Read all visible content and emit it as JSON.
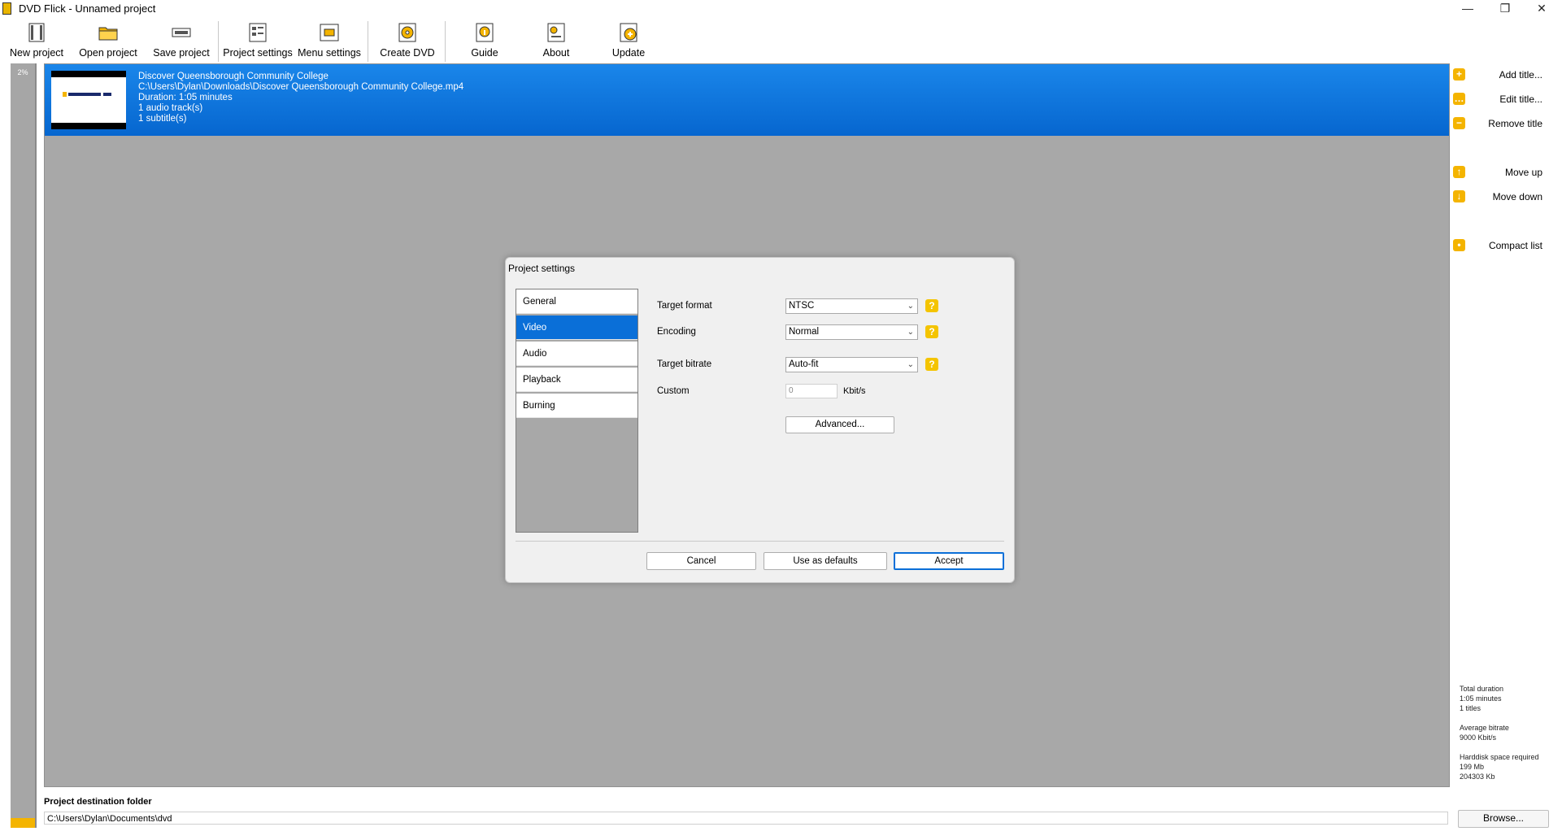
{
  "window": {
    "title": "DVD Flick - Unnamed project",
    "controls": {
      "minimize": "—",
      "restore": "❐",
      "close": "✕"
    }
  },
  "toolbar": {
    "items": [
      {
        "label": "New project",
        "icon": "new-project-icon"
      },
      {
        "label": "Open project",
        "icon": "folder-icon"
      },
      {
        "label": "Save project",
        "icon": "save-icon"
      },
      {
        "label": "Project settings",
        "icon": "project-settings-icon"
      },
      {
        "label": "Menu settings",
        "icon": "menu-settings-icon"
      },
      {
        "label": "Create DVD",
        "icon": "create-dvd-icon"
      },
      {
        "label": "Guide",
        "icon": "guide-icon"
      },
      {
        "label": "About",
        "icon": "about-icon"
      },
      {
        "label": "Update",
        "icon": "update-icon"
      }
    ]
  },
  "progress": {
    "label": "2%",
    "value": 0.02
  },
  "title_list": {
    "items": [
      {
        "name": "Discover Queensborough Community College",
        "path": "C:\\Users\\Dylan\\Downloads\\Discover Queensborough Community College.mp4",
        "duration": "Duration: 1:05 minutes",
        "audio": "1 audio track(s)",
        "subtitles": "1 subtitle(s)"
      }
    ]
  },
  "side_panel": {
    "add_title": "Add title...",
    "edit_title": "Edit title...",
    "remove_title": "Remove title",
    "move_up": "Move up",
    "move_down": "Move down",
    "compact_list": "Compact list"
  },
  "stats": {
    "duration_label": "Total duration",
    "duration_value": "1:05 minutes",
    "titles_count": "1 titles",
    "bitrate_label": "Average bitrate",
    "bitrate_value": "9000 Kbit/s",
    "space_label": "Harddisk space required",
    "space_mb": "199 Mb",
    "space_kb": "204303 Kb"
  },
  "destination": {
    "label": "Project destination folder",
    "value": "C:\\Users\\Dylan\\Documents\\dvd",
    "browse": "Browse..."
  },
  "dialog": {
    "title": "Project settings",
    "nav": [
      "General",
      "Video",
      "Audio",
      "Playback",
      "Burning"
    ],
    "active_tab": "Video",
    "fields": {
      "target_format_label": "Target format",
      "target_format_value": "NTSC",
      "encoding_label": "Encoding",
      "encoding_value": "Normal",
      "target_bitrate_label": "Target bitrate",
      "target_bitrate_value": "Auto-fit",
      "custom_label": "Custom",
      "custom_value": "0",
      "custom_unit": "Kbit/s",
      "help": "?"
    },
    "buttons": {
      "advanced": "Advanced...",
      "cancel": "Cancel",
      "use_defaults": "Use as defaults",
      "accept": "Accept"
    }
  },
  "colors": {
    "selection_blue": "#0a6fd8",
    "accent_yellow": "#f4b400",
    "list_gray": "#a8a8a8"
  }
}
